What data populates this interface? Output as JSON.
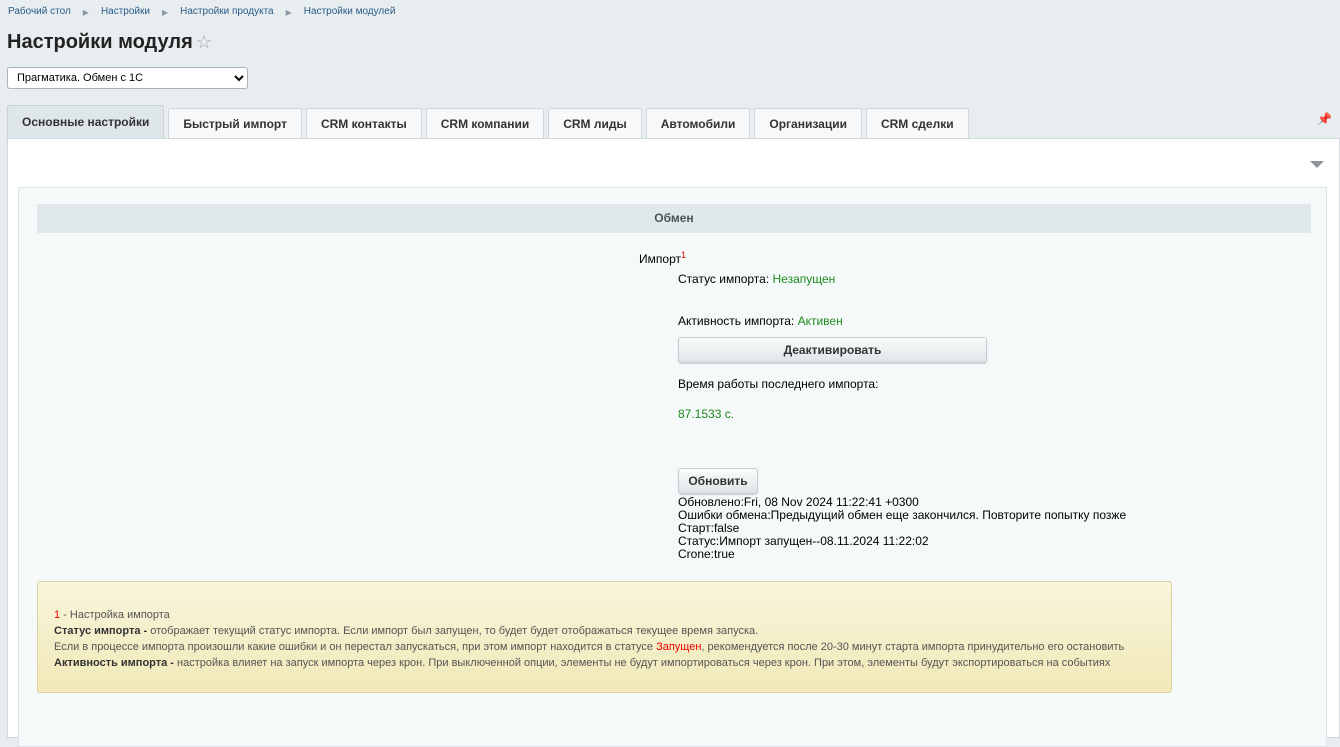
{
  "breadcrumbs": [
    "Рабочий стол",
    "Настройки",
    "Настройки продукта",
    "Настройки модулей"
  ],
  "page_title": "Настройки модуля",
  "module_select": "Прагматика. Обмен с 1С",
  "tabs": [
    "Основные настройки",
    "Быстрый импорт",
    "CRM контакты",
    "CRM компании",
    "CRM лиды",
    "Автомобили",
    "Организации",
    "CRM сделки"
  ],
  "section_title": "Обмен",
  "import_label": "Импорт",
  "import_footnote": "1",
  "status_label": "Статус импорта:",
  "status_value": "Незапущен",
  "activity_label": "Активность импорта:",
  "activity_value": "Активен",
  "deactivate_button": "Деактивировать",
  "last_time_label": "Время работы последнего импорта:",
  "last_time_value": "87.1533 с.",
  "refresh_button": "Обновить",
  "log": [
    "Обновлено:Fri, 08 Nov 2024 11:22:41 +0300",
    "Ошибки обмена:Предыдущий обмен еще закончился. Повторите попытку позже",
    "Старт:false",
    "Статус:Импорт запущен--08.11.2024 11:22:02",
    "Crone:true"
  ],
  "note": {
    "num": "1",
    "title": " - Настройка импорта",
    "l1_bold": "Статус импорта - ",
    "l1": "отображает текущий статус импорта. Если импорт был запущен, то будет будет отображаться текущее время запуска.",
    "l2a": "Если в процессе импорта произошли какие ошибки и он перестал запускаться, при этом импорт находится в статусе ",
    "l2red": "Запущен",
    "l2b": ", рекомендуется после 20-30 минут старта импорта принудительно его остановить",
    "l3_bold": "Активность импорта - ",
    "l3": "настройка влияет на запуск импорта через крон. При выключенной опции, элементы не будут импортироваться через крон. При этом, элементы будут экспортироваться на событиях"
  }
}
